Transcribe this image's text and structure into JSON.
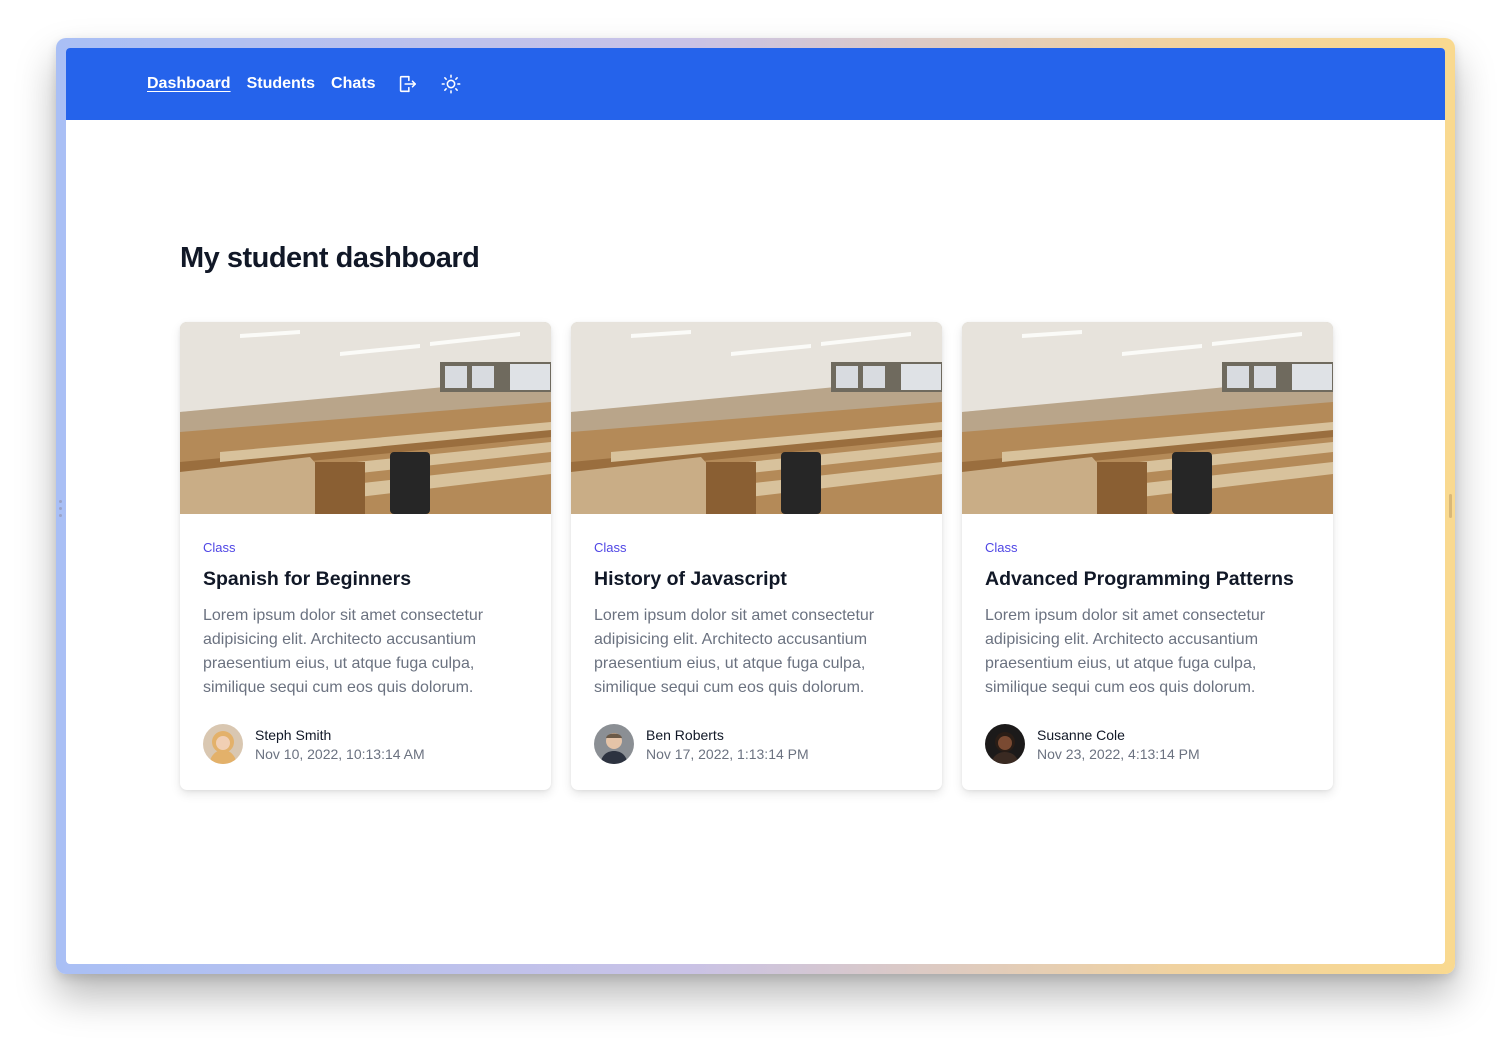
{
  "nav": {
    "links": [
      {
        "label": "Dashboard",
        "active": true
      },
      {
        "label": "Students",
        "active": false
      },
      {
        "label": "Chats",
        "active": false
      }
    ],
    "icons": [
      "logout-icon",
      "sun-icon"
    ]
  },
  "main": {
    "title": "My student dashboard"
  },
  "cards": [
    {
      "category": "Class",
      "title": "Spanish for Beginners",
      "description": "Lorem ipsum dolor sit amet consectetur adipisicing elit. Architecto accusantium praesentium eius, ut atque fuga culpa, similique sequi cum eos quis dolorum.",
      "author": "Steph Smith",
      "date": "Nov 10, 2022, 10:13:14 AM"
    },
    {
      "category": "Class",
      "title": "History of Javascript",
      "description": "Lorem ipsum dolor sit amet consectetur adipisicing elit. Architecto accusantium praesentium eius, ut atque fuga culpa, similique sequi cum eos quis dolorum.",
      "author": "Ben Roberts",
      "date": "Nov 17, 2022, 1:13:14 PM"
    },
    {
      "category": "Class",
      "title": "Advanced Programming Patterns",
      "description": "Lorem ipsum dolor sit amet consectetur adipisicing elit. Architecto accusantium praesentium eius, ut atque fuga culpa, similique sequi cum eos quis dolorum.",
      "author": "Susanne Cole",
      "date": "Nov 23, 2022, 4:13:14 PM"
    }
  ],
  "colors": {
    "nav_bg": "#2563eb",
    "category": "#4f46e5",
    "title": "#111827",
    "muted": "#6b7280"
  }
}
